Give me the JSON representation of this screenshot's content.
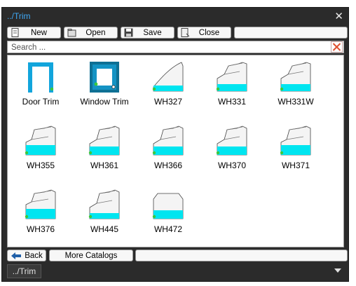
{
  "window": {
    "title": "../Trim"
  },
  "toolbar": {
    "new_label": "New",
    "open_label": "Open",
    "save_label": "Save",
    "close_label": "Close"
  },
  "search": {
    "placeholder": "Search ..."
  },
  "items": [
    {
      "name": "Door Trim",
      "icon": "door-trim-icon"
    },
    {
      "name": "Window Trim",
      "icon": "window-trim-icon"
    },
    {
      "name": "WH327",
      "icon": "profile-icon"
    },
    {
      "name": "WH331",
      "icon": "profile-icon"
    },
    {
      "name": "WH331W",
      "icon": "profile-icon"
    },
    {
      "name": "WH355",
      "icon": "profile-icon"
    },
    {
      "name": "WH361",
      "icon": "profile-icon"
    },
    {
      "name": "WH366",
      "icon": "profile-icon"
    },
    {
      "name": "WH370",
      "icon": "profile-icon"
    },
    {
      "name": "WH371",
      "icon": "profile-icon"
    },
    {
      "name": "WH376",
      "icon": "profile-icon"
    },
    {
      "name": "WH445",
      "icon": "profile-icon"
    },
    {
      "name": "WH472",
      "icon": "profile-icon"
    }
  ],
  "bottombar": {
    "back_label": "Back",
    "more_label": "More Catalogs"
  },
  "path_tab": "../Trim",
  "colors": {
    "accent": "#3fa9f5",
    "cyan": "#00e5f0",
    "node": "#3cc83c",
    "frame": "#2b2b2b"
  }
}
